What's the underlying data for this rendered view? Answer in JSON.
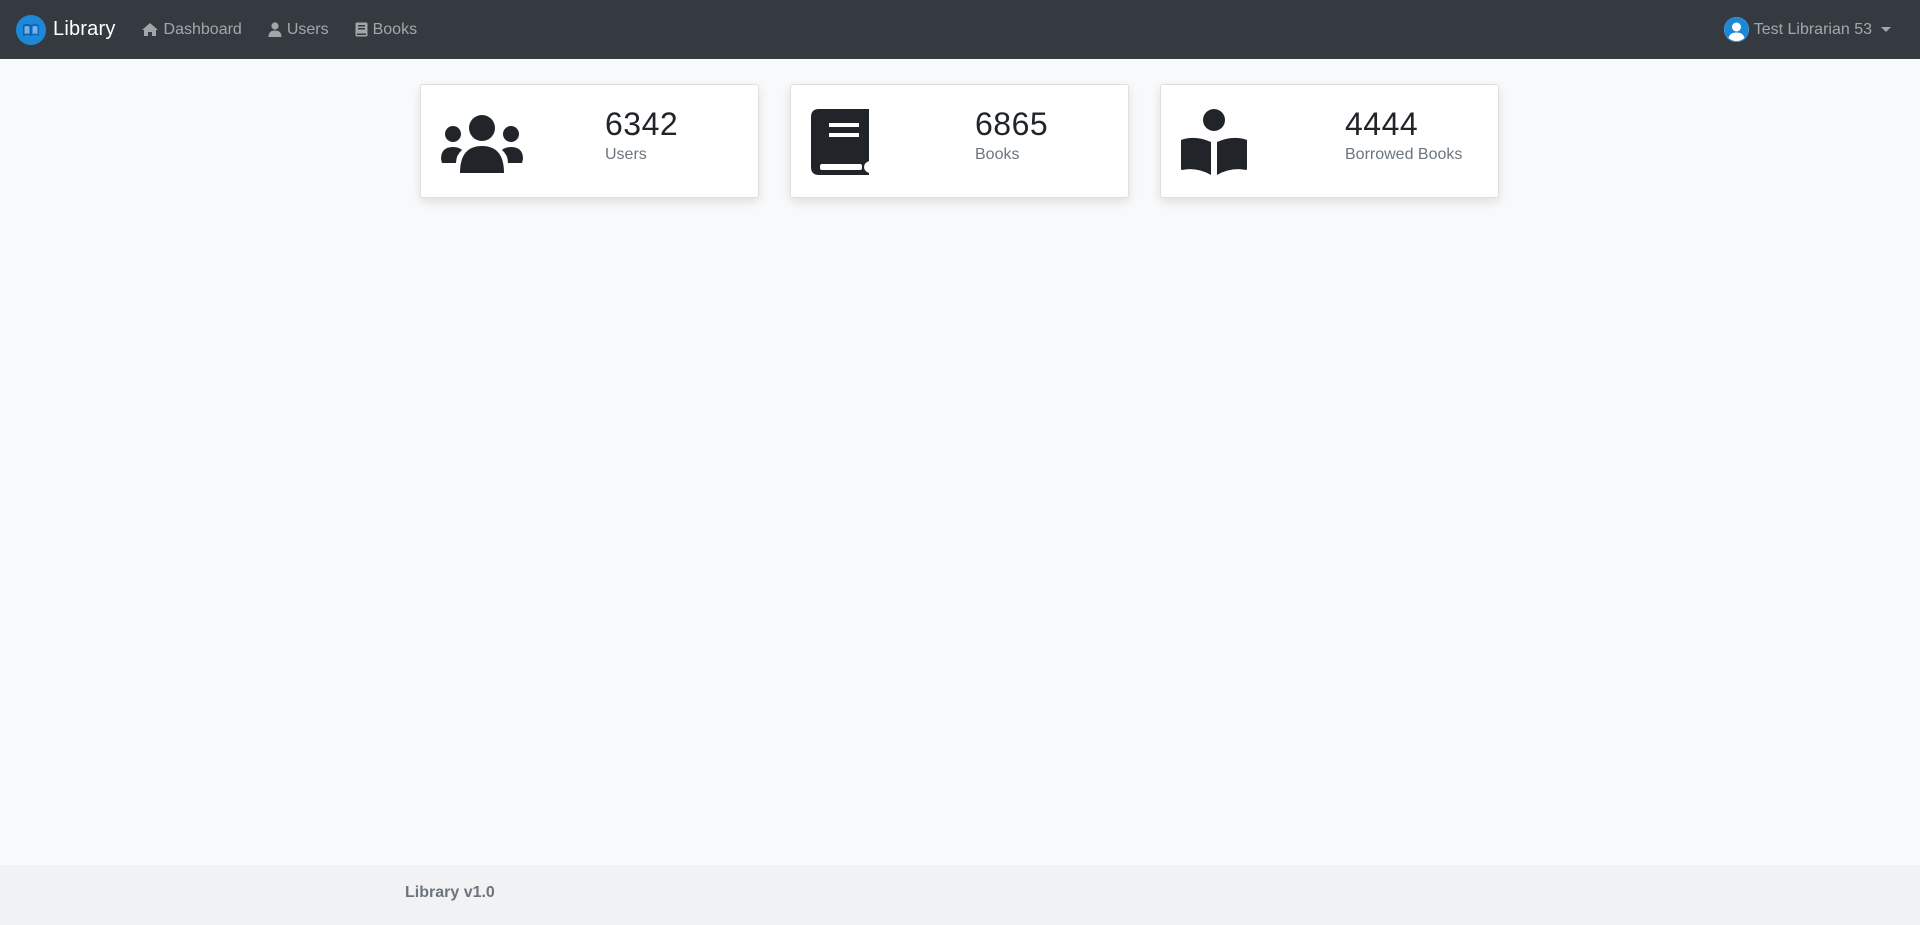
{
  "navbar": {
    "brand": "Library",
    "links": [
      {
        "label": "Dashboard",
        "icon": "home-icon"
      },
      {
        "label": "Users",
        "icon": "user-icon"
      },
      {
        "label": "Books",
        "icon": "book-icon"
      }
    ],
    "user_name": "Test Librarian 53"
  },
  "stats": [
    {
      "value": "6342",
      "label": "Users",
      "icon": "users-group-icon"
    },
    {
      "value": "6865",
      "label": "Books",
      "icon": "book-icon"
    },
    {
      "value": "4444",
      "label": "Borrowed Books",
      "icon": "book-reader-icon"
    }
  ],
  "footer": {
    "text": "Library v1.0"
  },
  "colors": {
    "navbar_bg": "#343a40",
    "brand_logo": "#1e88d8",
    "page_bg": "#f8f9fa",
    "footer_bg": "#f1f2f3"
  }
}
